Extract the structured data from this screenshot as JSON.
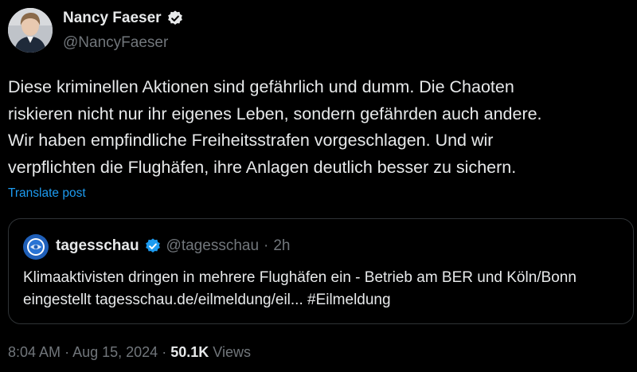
{
  "author": {
    "name": "Nancy Faeser",
    "handle": "@NancyFaeser",
    "verified_icon": "verified-badge-icon"
  },
  "tweet": {
    "text": "Diese kriminellen Aktionen sind gefährlich und dumm. Die Chaoten\nriskieren nicht nur ihr eigenes Leben, sondern gefährden auch andere.\nWir haben empfindliche Freiheitsstrafen vorgeschlagen. Und wir\nverpflichten die Flughäfen, ihre Anlagen deutlich besser zu sichern.",
    "translate_label": "Translate post"
  },
  "quote": {
    "name": "tagesschau",
    "handle": "@tagesschau",
    "separator": "·",
    "time": "2h",
    "text": "Klimaaktivisten dringen in mehrere Flughäfen ein - Betrieb am BER und Köln/Bonn eingestellt tagesschau.de/eilmeldung/eil... #Eilmeldung"
  },
  "footer": {
    "time": "8:04 AM",
    "separator": "·",
    "date": "Aug 15, 2024",
    "separator2": "·",
    "views_count": "50.1K",
    "views_label": "Views"
  },
  "colors": {
    "background": "#000000",
    "text": "#e7e9ea",
    "secondary": "#71767b",
    "accent": "#1d9bf0",
    "border": "#2f3336"
  }
}
